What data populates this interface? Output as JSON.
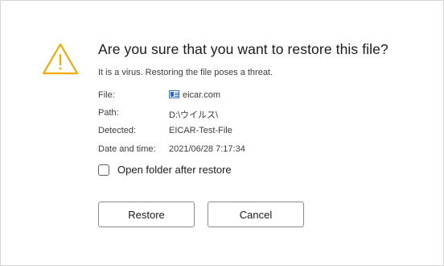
{
  "dialog": {
    "title": "Are you sure that you want to restore this file?",
    "subtitle": "It is a virus. Restoring the file poses a threat.",
    "icon": "warning-triangle-icon",
    "accent_color": "#f2a900",
    "details": [
      {
        "label": "File:",
        "value": "eicar.com",
        "icon": "file-icon"
      },
      {
        "label": "Path:",
        "value": "D:\\ウイルス\\"
      },
      {
        "label": "Detected:",
        "value": "EICAR-Test-File"
      },
      {
        "label": "Date and time:",
        "value": "2021/06/28 7:17:34"
      }
    ],
    "checkbox": {
      "label": "Open folder after restore",
      "checked": false
    },
    "buttons": {
      "restore": "Restore",
      "cancel": "Cancel"
    }
  }
}
